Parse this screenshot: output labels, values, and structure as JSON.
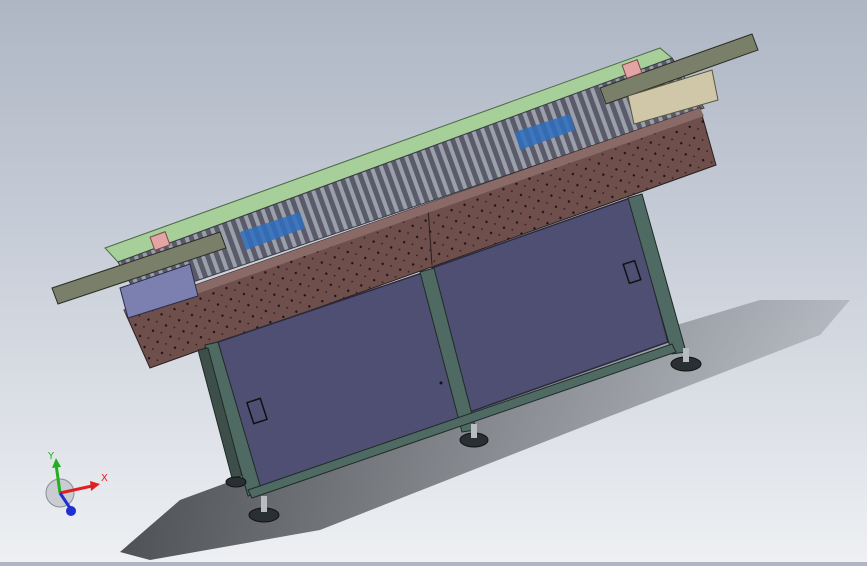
{
  "viewport": {
    "model_icon": "machine-assembly-3d-model"
  },
  "triad": {
    "x_label": "X",
    "y_label": "Y",
    "colors": {
      "x": "#e02020",
      "y": "#20b020",
      "z": "#2030d0"
    }
  },
  "colors": {
    "frame_brown": "#6e4f4c",
    "panel_blue": "#4f4f74",
    "rail_green": "#a6cf9a",
    "roller_blue": "#2f6fc0",
    "leg_steel": "#4f6a62"
  }
}
